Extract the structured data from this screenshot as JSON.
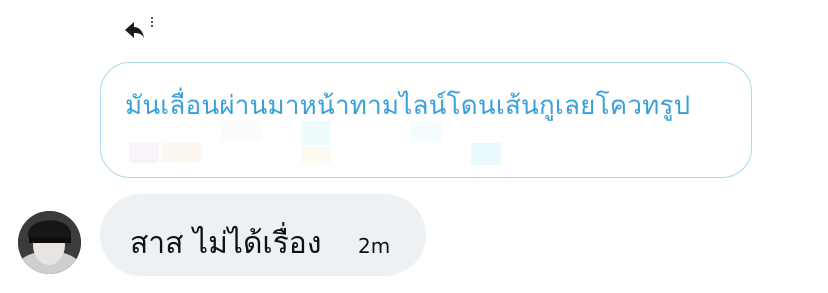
{
  "reply": {
    "icon": "reply-arrow-icon",
    "menu_icon": "vertical-dots-icon"
  },
  "quoted_message": {
    "text": "มันเลื่อนผ่านมาหน้าทามไลน์โดนเส้นกูเลยโควทรูป",
    "border_color": "#a9d8f0",
    "text_color": "#3aa0dc"
  },
  "message": {
    "text": "สาส ไม่ได้เรื่อง",
    "time": "2m",
    "bubble_color": "#eef1f4"
  },
  "sender": {
    "avatar_icon": "avatar"
  }
}
